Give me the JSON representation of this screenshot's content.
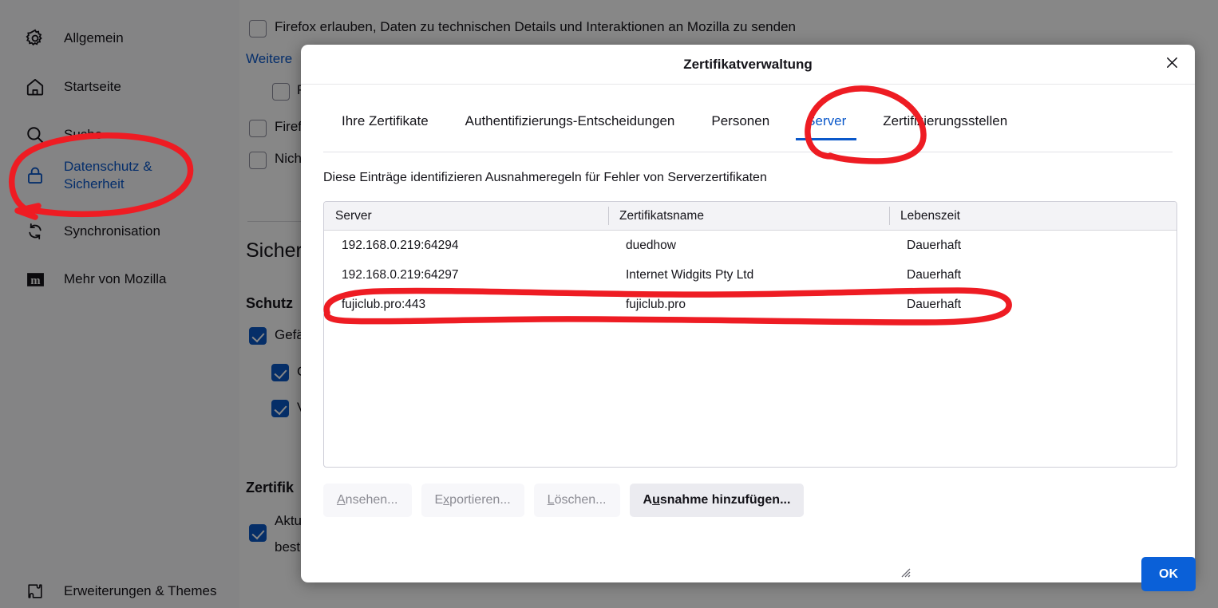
{
  "sidebar": {
    "items": [
      {
        "label": "Allgemein",
        "icon": "gear-icon",
        "name": "allgemein",
        "active": false
      },
      {
        "label": "Startseite",
        "icon": "home-icon",
        "name": "startseite",
        "active": false
      },
      {
        "label": "Suche",
        "icon": "search-icon",
        "name": "suche",
        "active": false
      },
      {
        "label": "Datenschutz &",
        "label2": "Sicherheit",
        "icon": "lock-icon",
        "name": "datenschutz-sicherheit",
        "active": true
      },
      {
        "label": "Synchronisation",
        "icon": "sync-icon",
        "name": "synchronisation",
        "active": false
      },
      {
        "label": "Mehr von Mozilla",
        "icon": "mozilla-icon",
        "name": "mehr-von-mozilla",
        "active": false
      }
    ],
    "footer": {
      "label": "Erweiterungen & Themes",
      "icon": "puzzle-icon"
    }
  },
  "background": {
    "telemetry_checkbox_label": "Firefox erlauben, Daten zu technischen Details und Interaktionen an Mozilla zu senden",
    "more_link": "Weitere",
    "checkbox_p": "P",
    "checkbox_firefox": "Firef",
    "checkbox_nicht": "Nich",
    "heading_sicherheit": "Sicher",
    "heading_schutz": "Schutz",
    "label_gefaehrlich": "Gefä",
    "label_sub_g": "G",
    "label_sub_v": "V",
    "heading_zertifikate": "Zertifik",
    "label_aktuell": "Aktu",
    "label_bestaetigen": "best"
  },
  "dialog": {
    "title": "Zertifikatverwaltung",
    "close_icon": "close-icon",
    "tabs": [
      {
        "label": "Ihre Zertifikate",
        "selected": false
      },
      {
        "label": "Authentifizierungs-Entscheidungen",
        "selected": false
      },
      {
        "label": "Personen",
        "selected": false
      },
      {
        "label": "Server",
        "selected": true
      },
      {
        "label": "Zertifizierungsstellen",
        "selected": false
      }
    ],
    "description": "Diese Einträge identifizieren Ausnahmeregeln für Fehler von Serverzertifikaten",
    "table": {
      "columns": [
        "Server",
        "Zertifikatsname",
        "Lebenszeit"
      ],
      "rows": [
        [
          "192.168.0.219:64294",
          "duedhow",
          "Dauerhaft"
        ],
        [
          "192.168.0.219:64297",
          "Internet Widgits Pty Ltd",
          "Dauerhaft"
        ],
        [
          "fujiclub.pro:443",
          "fujiclub.pro",
          "Dauerhaft"
        ]
      ]
    },
    "buttons": [
      {
        "prefix": "",
        "key": "A",
        "suffix": "nsehen...",
        "disabled": true,
        "name": "view-button"
      },
      {
        "prefix": "E",
        "key": "x",
        "suffix": "portieren...",
        "disabled": true,
        "name": "export-button"
      },
      {
        "prefix": "",
        "key": "L",
        "suffix": "öschen...",
        "disabled": true,
        "name": "delete-button"
      },
      {
        "prefix": "A",
        "key": "u",
        "suffix": "snahme hinzufügen...",
        "disabled": false,
        "name": "add-exception-button"
      }
    ],
    "ok_label": "OK"
  },
  "colors": {
    "accent": "#0a58ca",
    "ok_button": "#0a60d8",
    "annotation_ink": "#ee1c23",
    "checkbox_checked": "#0b57c4"
  },
  "annotations": [
    {
      "name": "sidebar-privacy-circle",
      "target": "Datenschutz & Sicherheit"
    },
    {
      "name": "server-tab-circle",
      "target": "Server"
    },
    {
      "name": "fujiclub-row-circle",
      "target": "fujiclub.pro:443"
    }
  ]
}
